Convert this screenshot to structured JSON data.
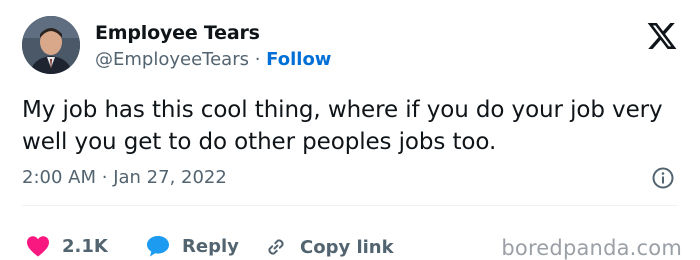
{
  "author": {
    "display_name": "Employee Tears",
    "handle": "@EmployeeTears",
    "separator": "·",
    "follow_label": "Follow"
  },
  "tweet": {
    "text": "My job has this cool thing, where if you do your job very well you get to do other peoples jobs too.",
    "time": "2:00 AM",
    "date_separator": "·",
    "date": "Jan 27, 2022"
  },
  "actions": {
    "like_count": "2.1K",
    "reply_label": "Reply",
    "copy_label": "Copy link"
  },
  "icons": {
    "logo": "x-logo-icon",
    "info": "info-icon",
    "like": "heart-icon",
    "reply": "speech-bubble-icon",
    "copy": "link-icon"
  },
  "colors": {
    "like": "#f91880",
    "reply": "#1d9bf0",
    "follow": "#006fd6",
    "secondary_text": "#536471"
  },
  "watermark": "boredpanda.com"
}
